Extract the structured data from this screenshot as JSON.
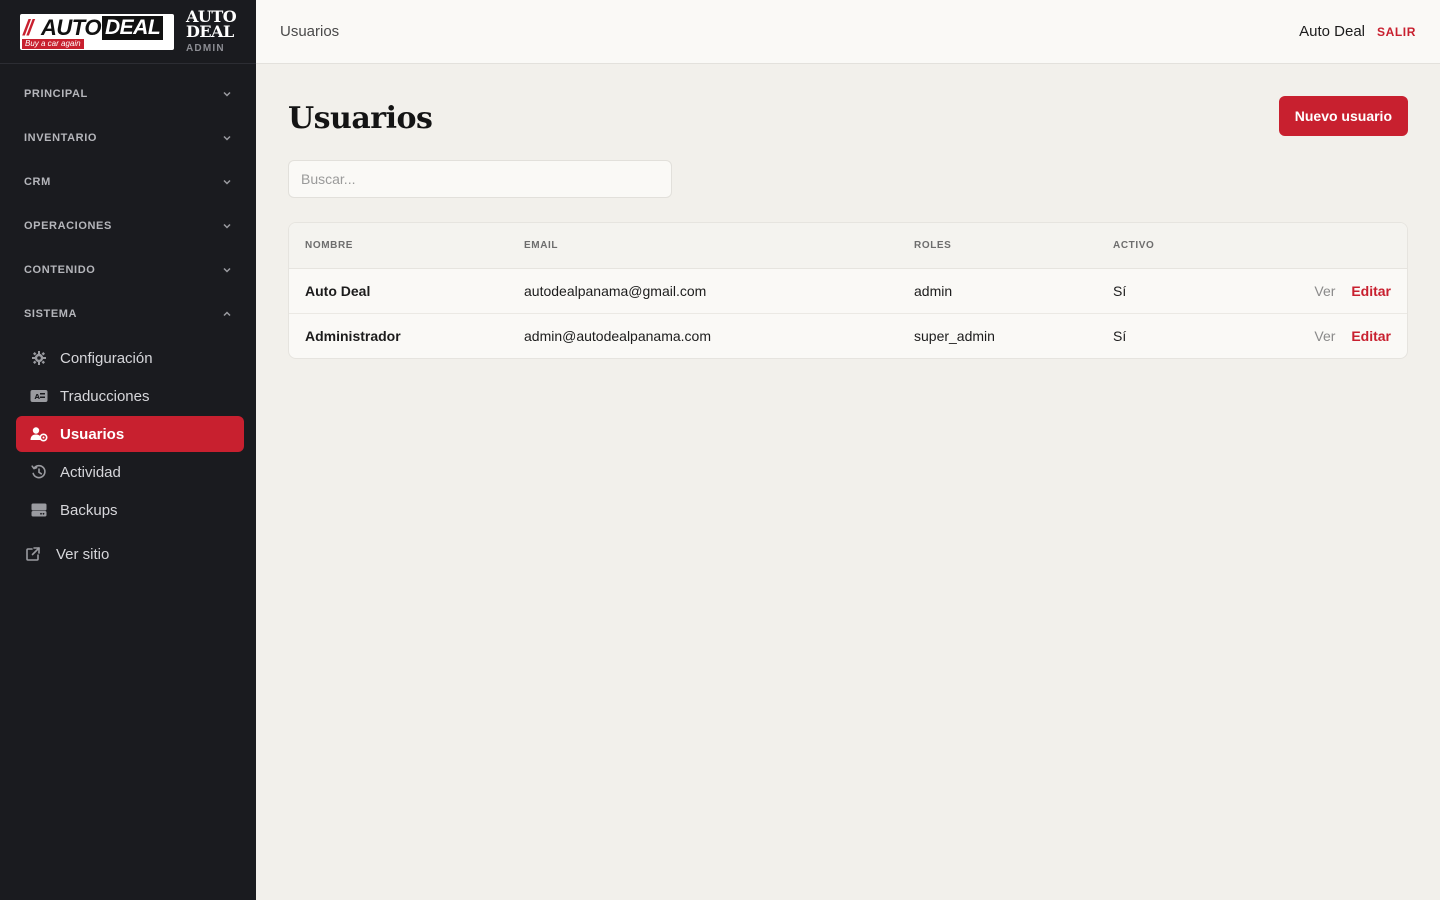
{
  "brand": {
    "logo_slashes": "//",
    "logo_auto": "AUTO",
    "logo_deal": "DEAL",
    "logo_tagline": "Buy a car again",
    "title_line1": "AUTO",
    "title_line2": "DEAL",
    "subtitle": "ADMIN"
  },
  "sidebar": {
    "groups": [
      {
        "label": "PRINCIPAL",
        "expanded": false
      },
      {
        "label": "INVENTARIO",
        "expanded": false
      },
      {
        "label": "CRM",
        "expanded": false
      },
      {
        "label": "OPERACIONES",
        "expanded": false
      },
      {
        "label": "CONTENIDO",
        "expanded": false
      },
      {
        "label": "SISTEMA",
        "expanded": true
      }
    ],
    "sistema_items": [
      {
        "label": "Configuración",
        "icon": "gear-icon"
      },
      {
        "label": "Traducciones",
        "icon": "translate-icon"
      },
      {
        "label": "Usuarios",
        "icon": "users-icon",
        "active": true
      },
      {
        "label": "Actividad",
        "icon": "history-icon"
      },
      {
        "label": "Backups",
        "icon": "storage-icon"
      }
    ],
    "site_link": {
      "label": "Ver sitio",
      "icon": "external-link-icon"
    }
  },
  "topbar": {
    "breadcrumb": "Usuarios",
    "user_name": "Auto Deal",
    "logout_label": "SALIR"
  },
  "main": {
    "title": "Usuarios",
    "new_button_label": "Nuevo usuario",
    "search_placeholder": "Buscar..."
  },
  "table": {
    "columns": [
      "NOMBRE",
      "EMAIL",
      "ROLES",
      "ACTIVO"
    ],
    "rows": [
      {
        "nombre": "Auto Deal",
        "email": "autodealpanama@gmail.com",
        "roles": "admin",
        "activo": "Sí",
        "view_label": "Ver",
        "edit_label": "Editar"
      },
      {
        "nombre": "Administrador",
        "email": "admin@autodealpanama.com",
        "roles": "super_admin",
        "activo": "Sí",
        "view_label": "Ver",
        "edit_label": "Editar"
      }
    ]
  },
  "colors": {
    "accent": "#c8202f",
    "sidebar_bg": "#1a1b1f",
    "page_bg": "#f2f0eb"
  }
}
